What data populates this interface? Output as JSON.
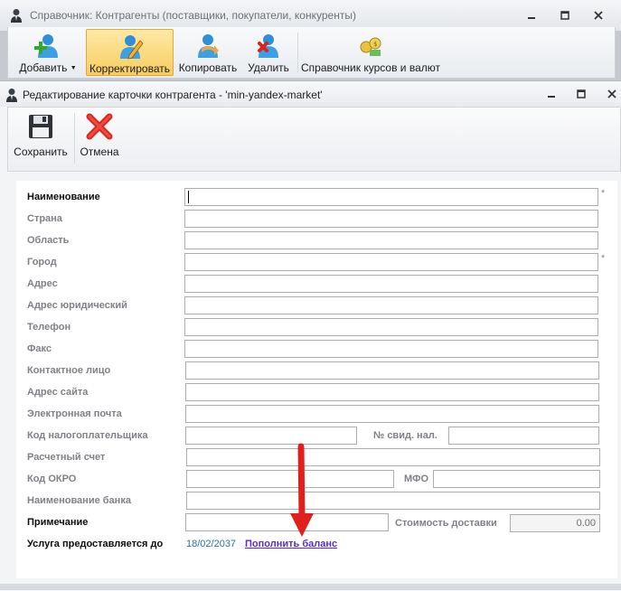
{
  "outer_window": {
    "title": "Справочник: Контрагенты (поставщики, покупатели, конкуренты)",
    "toolbar": [
      {
        "label": "Добавить",
        "icon": "add-user-icon",
        "has_dropdown": true
      },
      {
        "label": "Корректировать",
        "icon": "edit-user-icon",
        "active": true
      },
      {
        "label": "Копировать",
        "icon": "copy-user-icon"
      },
      {
        "label": "Удалить",
        "icon": "delete-user-icon"
      },
      {
        "label": "Справочник курсов и валют",
        "icon": "currency-rates-icon"
      }
    ]
  },
  "dialog": {
    "title": "Редактирование карточки контрагента - 'min-yandex-market'",
    "toolbar": {
      "save_label": "Сохранить",
      "cancel_label": "Отмена"
    }
  },
  "form": {
    "name_label": "Наименование",
    "country_label": "Страна",
    "region_label": "Область",
    "city_label": "Город",
    "address_label": "Адрес",
    "legal_address_label": "Адрес юридический",
    "phone_label": "Телефон",
    "fax_label": "Факс",
    "contact_label": "Контактное лицо",
    "website_label": "Адрес сайта",
    "email_label": "Электронная почта",
    "taxpayer_code_label": "Код налогоплательщика",
    "tax_cert_label": "№ свид. нал.",
    "account_label": "Расчетный счет",
    "okpo_label": "Код ОКРО",
    "mfo_label": "МФО",
    "bank_name_label": "Наименование банка",
    "note_label": "Примечание",
    "delivery_cost_label": "Стоимость доставки",
    "delivery_cost_value": "0.00",
    "service_until_label": "Услуга предоставляется до",
    "service_until_date": "18/02/2037",
    "top_up_link": "Пополнить баланс",
    "required_marker": "*"
  },
  "colors": {
    "active_button": "#f8cd5e",
    "link": "#5a2bd6",
    "date": "#2a6fb0",
    "annotation_arrow": "#e0201c"
  }
}
